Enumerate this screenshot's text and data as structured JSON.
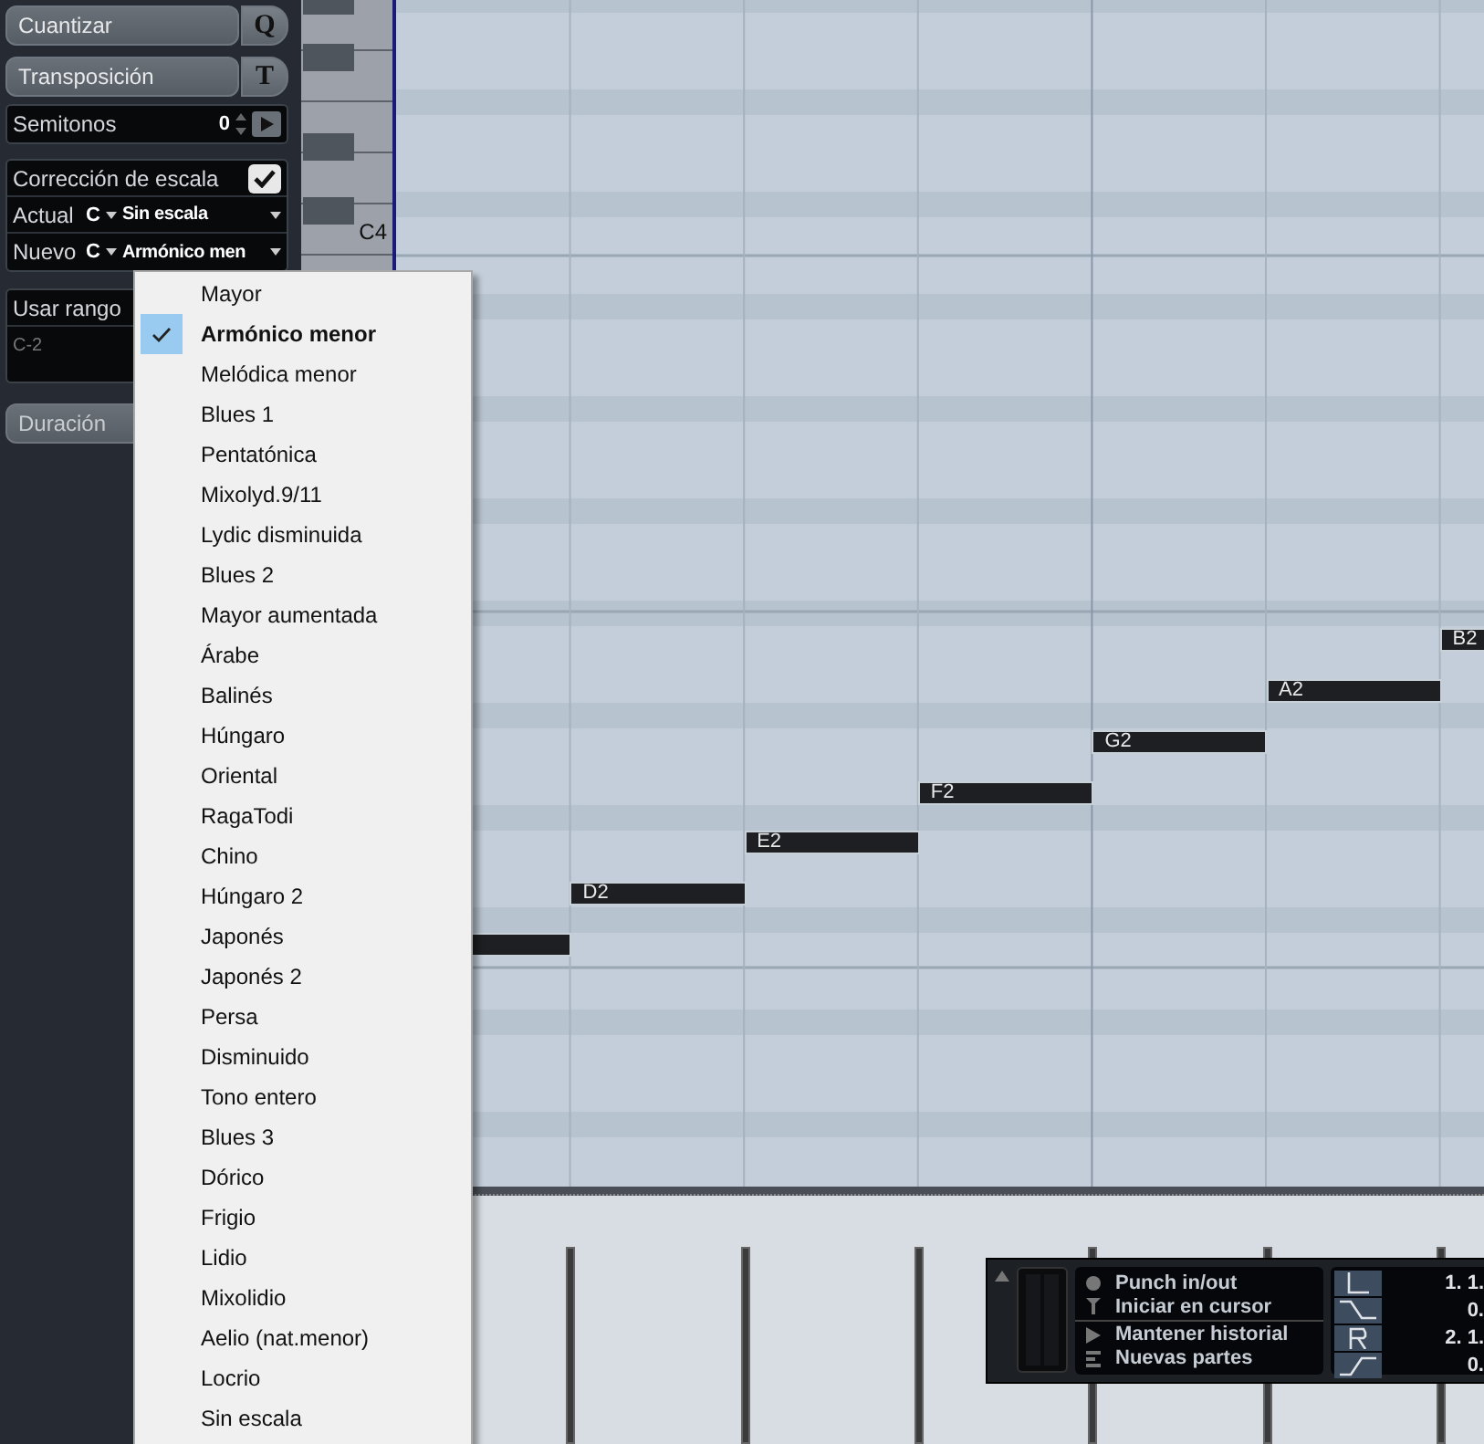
{
  "quantize": {
    "label": "Cuantizar",
    "key": "Q"
  },
  "transpose": {
    "label": "Transposición",
    "key": "T",
    "semitones": {
      "label": "Semitonos",
      "value": "0"
    }
  },
  "scale_correction": {
    "label": "Corrección de escala",
    "checked": true,
    "rows": [
      {
        "label": "Actual",
        "root": "C",
        "scale": "Sin escala"
      },
      {
        "label": "Nuevo",
        "root": "C",
        "scale": "Armónico men"
      }
    ]
  },
  "range": {
    "label": "Usar rango",
    "low": "C-2"
  },
  "duration": {
    "label": "Duración"
  },
  "piano": {
    "label": "C4"
  },
  "notes": [
    {
      "kind": "note"
    },
    {
      "kind": "note",
      "label": "D2"
    },
    {
      "kind": "note",
      "label": "E2"
    },
    {
      "kind": "note",
      "label": "F2"
    },
    {
      "kind": "note",
      "label": "G2"
    },
    {
      "kind": "note",
      "label": "A2"
    },
    {
      "kind": "note",
      "label": "B2"
    }
  ],
  "scale_menu": [
    {
      "label": "Mayor",
      "selected": false
    },
    {
      "label": "Armónico menor",
      "selected": true
    },
    {
      "label": "Melódica menor",
      "selected": false
    },
    {
      "label": "Blues 1",
      "selected": false
    },
    {
      "label": "Pentatónica",
      "selected": false
    },
    {
      "label": "Mixolyd.9/11",
      "selected": false
    },
    {
      "label": "Lydic disminuida",
      "selected": false
    },
    {
      "label": "Blues 2",
      "selected": false
    },
    {
      "label": "Mayor aumentada",
      "selected": false
    },
    {
      "label": "Árabe",
      "selected": false
    },
    {
      "label": "Balinés",
      "selected": false
    },
    {
      "label": "Húngaro",
      "selected": false
    },
    {
      "label": "Oriental",
      "selected": false
    },
    {
      "label": "RagaTodi",
      "selected": false
    },
    {
      "label": "Chino",
      "selected": false
    },
    {
      "label": "Húngaro 2",
      "selected": false
    },
    {
      "label": "Japonés",
      "selected": false
    },
    {
      "label": "Japonés 2",
      "selected": false
    },
    {
      "label": "Persa",
      "selected": false
    },
    {
      "label": "Disminuido",
      "selected": false
    },
    {
      "label": "Tono entero",
      "selected": false
    },
    {
      "label": "Blues 3",
      "selected": false
    },
    {
      "label": "Dórico",
      "selected": false
    },
    {
      "label": "Frigio",
      "selected": false
    },
    {
      "label": "Lidio",
      "selected": false
    },
    {
      "label": "Mixolidio",
      "selected": false
    },
    {
      "label": "Aelio (nat.menor)",
      "selected": false
    },
    {
      "label": "Locrio",
      "selected": false
    },
    {
      "label": "Sin escala",
      "selected": false
    }
  ],
  "transport": {
    "options": [
      {
        "kind": "record",
        "label": "Punch in/out"
      },
      {
        "kind": "cursor",
        "label": "Iniciar en cursor"
      },
      {
        "kind": "play",
        "label": "Mantener historial"
      },
      {
        "kind": "parts",
        "label": "Nuevas partes"
      }
    ],
    "locators": [
      {
        "kind": "left",
        "value": "1. 1."
      },
      {
        "kind": "fall",
        "value": "0."
      },
      {
        "kind": "right",
        "value": "2. 1."
      },
      {
        "kind": "rise",
        "value": "0."
      }
    ]
  }
}
